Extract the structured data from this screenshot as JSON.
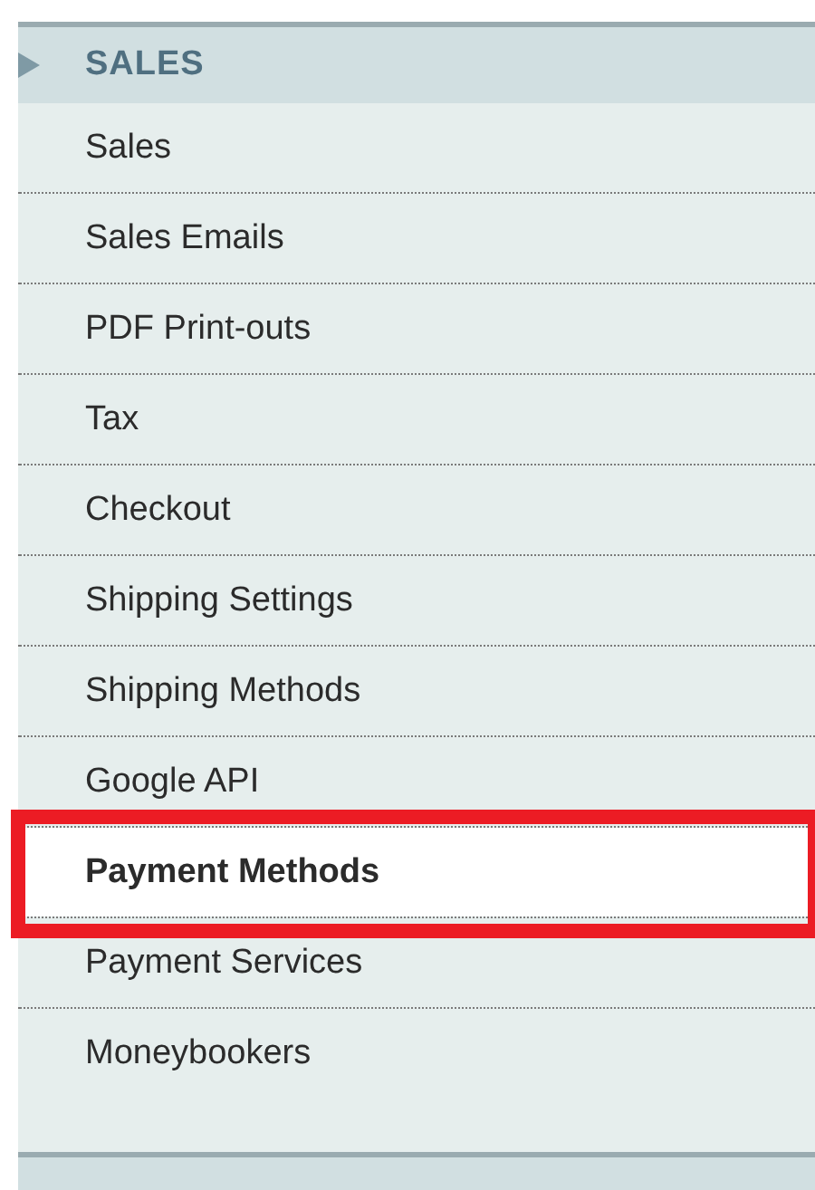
{
  "section": {
    "title": "SALES",
    "expanded": true
  },
  "items": [
    {
      "label": "Sales",
      "selected": false
    },
    {
      "label": "Sales Emails",
      "selected": false
    },
    {
      "label": "PDF Print-outs",
      "selected": false
    },
    {
      "label": "Tax",
      "selected": false
    },
    {
      "label": "Checkout",
      "selected": false
    },
    {
      "label": "Shipping Settings",
      "selected": false
    },
    {
      "label": "Shipping Methods",
      "selected": false
    },
    {
      "label": "Google API",
      "selected": false
    },
    {
      "label": "Payment Methods",
      "selected": true
    },
    {
      "label": "Payment Services",
      "selected": false
    },
    {
      "label": "Moneybookers",
      "selected": false
    }
  ]
}
